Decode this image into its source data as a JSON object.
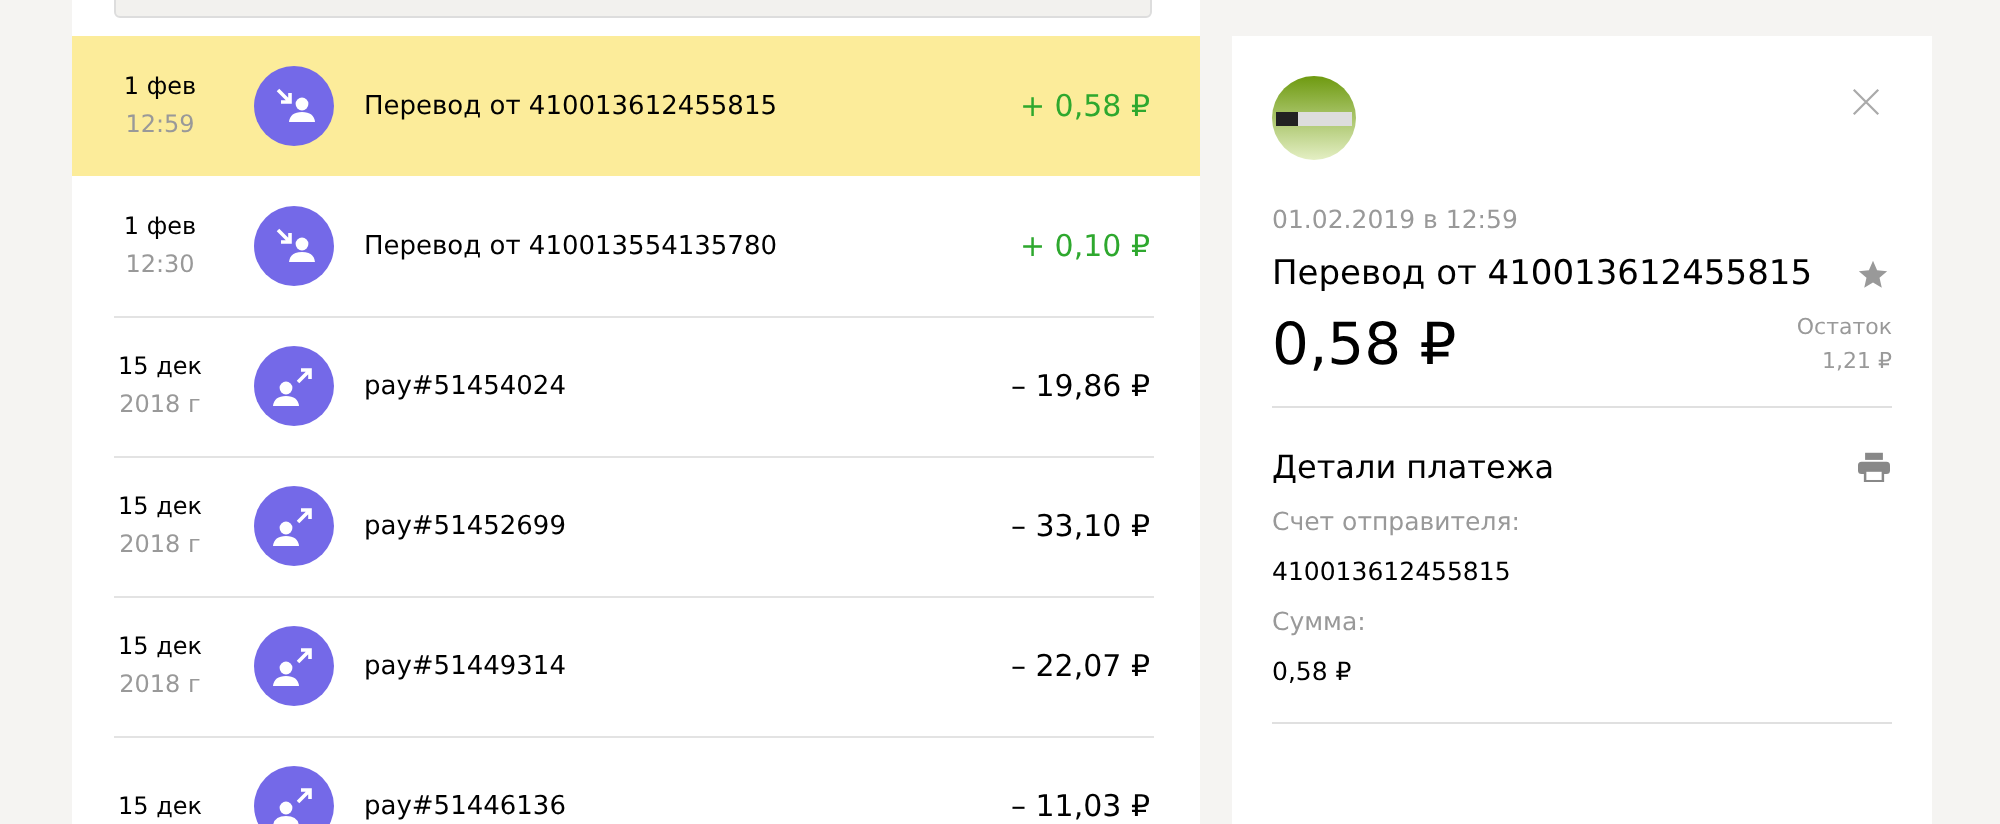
{
  "transactions": [
    {
      "kind": "incoming",
      "date": "1 фев",
      "sub": "12:59",
      "name": "Перевод от 410013612455815",
      "amount": "+ 0,58 ₽",
      "selected": true
    },
    {
      "kind": "incoming",
      "date": "1 фев",
      "sub": "12:30",
      "name": "Перевод от 410013554135780",
      "amount": "+ 0,10 ₽",
      "selected": false
    },
    {
      "kind": "outgoing",
      "date": "15 дек",
      "sub": "2018 г",
      "name": "pay#51454024",
      "amount": "– 19,86 ₽",
      "selected": false
    },
    {
      "kind": "outgoing",
      "date": "15 дек",
      "sub": "2018 г",
      "name": "pay#51452699",
      "amount": "– 33,10 ₽",
      "selected": false
    },
    {
      "kind": "outgoing",
      "date": "15 дек",
      "sub": "2018 г",
      "name": "pay#51449314",
      "amount": "– 22,07 ₽",
      "selected": false
    },
    {
      "kind": "outgoing",
      "date": "15 дек",
      "name": "pay#51446136",
      "amount": "– 11,03 ₽",
      "selected": false
    }
  ],
  "detail": {
    "datetime": "01.02.2019 в 12:59",
    "title": "Перевод от 410013612455815",
    "amount": "0,58 ₽",
    "balance_label": "Остаток",
    "balance": "1,21 ₽",
    "section_title": "Детали платежа",
    "fields": [
      {
        "label": "Счет отправителя:",
        "value": "410013612455815"
      },
      {
        "label": "Сумма:",
        "value": "0,58 ₽"
      }
    ]
  }
}
